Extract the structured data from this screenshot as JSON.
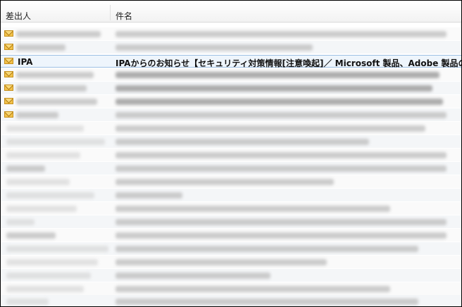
{
  "columns": {
    "sender": "差出人",
    "subject": "件名"
  },
  "selected_message": {
    "sender": "IPA",
    "subject": "IPAからのお知らせ【セキュリティ対策情報[注意喚起]／ Microsoft 製品、Adobe 製品の脆弱性"
  },
  "icons": {
    "unread": "envelope-icon"
  },
  "colors": {
    "selected_row": "#eef5fc",
    "selected_border": "#9dc0e4",
    "envelope": "#f2c24b"
  }
}
